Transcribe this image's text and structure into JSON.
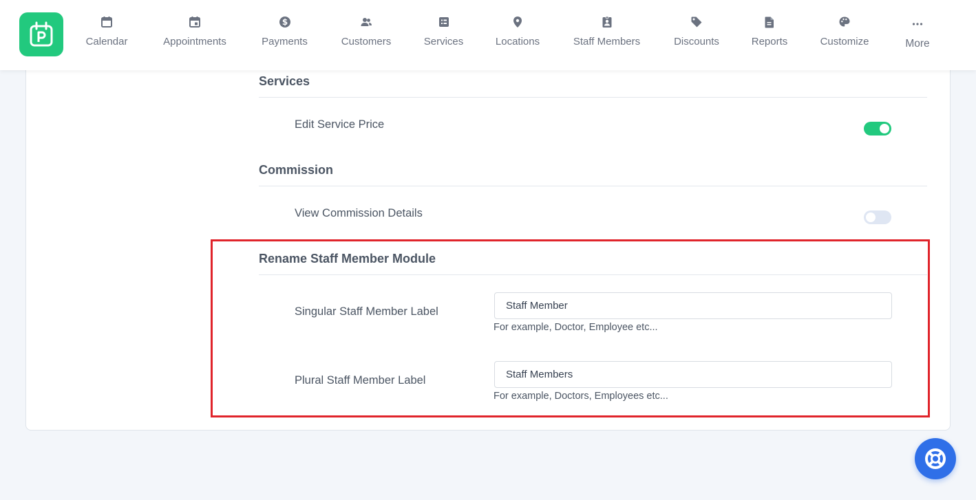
{
  "nav": {
    "items": [
      {
        "label": "Calendar",
        "icon": "calendar-icon"
      },
      {
        "label": "Appointments",
        "icon": "appointment-calendar-icon"
      },
      {
        "label": "Payments",
        "icon": "dollar-circle-icon"
      },
      {
        "label": "Customers",
        "icon": "people-icon"
      },
      {
        "label": "Services",
        "icon": "services-list-icon"
      },
      {
        "label": "Locations",
        "icon": "location-pin-icon"
      },
      {
        "label": "Staff Members",
        "icon": "staff-badge-icon"
      },
      {
        "label": "Discounts",
        "icon": "tag-icon"
      },
      {
        "label": "Reports",
        "icon": "report-file-icon"
      },
      {
        "label": "Customize",
        "icon": "palette-icon"
      }
    ],
    "more_label": "More"
  },
  "services_section": {
    "title": "Services",
    "edit_price_label": "Edit Service Price",
    "edit_price_enabled": true
  },
  "commission_section": {
    "title": "Commission",
    "view_details_label": "View Commission Details",
    "view_details_enabled": false
  },
  "rename_section": {
    "title": "Rename Staff Member Module",
    "singular": {
      "label": "Singular Staff Member Label",
      "value": "Staff Member",
      "help": "For example, Doctor, Employee etc..."
    },
    "plural": {
      "label": "Plural Staff Member Label",
      "value": "Staff Members",
      "help": "For example, Doctors, Employees etc..."
    }
  },
  "colors": {
    "brand": "#22c97e",
    "toggle_off": "#dfe6f3",
    "highlight": "#e0242b",
    "help_button": "#2f6fe8"
  },
  "help_button": {
    "icon": "lifebuoy-icon"
  }
}
